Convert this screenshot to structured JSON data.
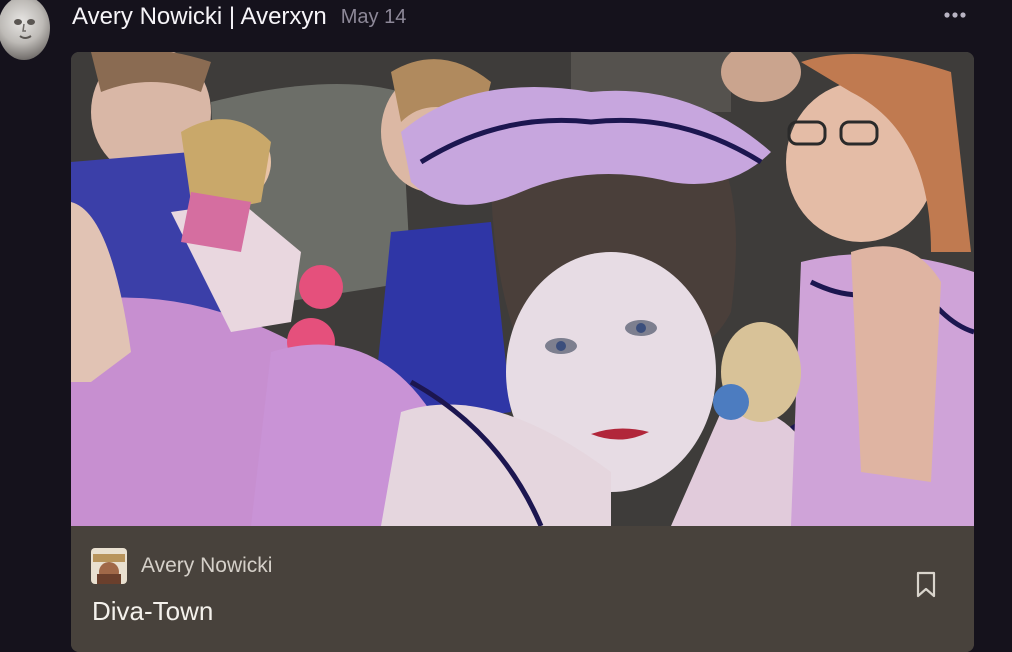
{
  "post": {
    "author": "Avery Nowicki | Averxyn",
    "date": "May 14"
  },
  "embed": {
    "author": "Avery Nowicki",
    "title": "Diva-Town"
  },
  "colors": {
    "background": "#15121c",
    "card_footer": "#48423c",
    "muted_text": "#8d8898"
  },
  "icons": {
    "more": "more-horizontal-icon",
    "bookmark": "bookmark-icon"
  }
}
